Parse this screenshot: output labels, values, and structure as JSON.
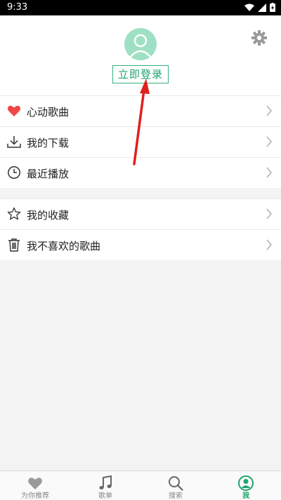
{
  "status": {
    "time": "9:33"
  },
  "profile": {
    "login_label": "立即登录"
  },
  "menu_group_1": [
    {
      "label": "心动歌曲",
      "icon": "heart-icon"
    },
    {
      "label": "我的下载",
      "icon": "download-icon"
    },
    {
      "label": "最近播放",
      "icon": "clock-icon"
    }
  ],
  "menu_group_2": [
    {
      "label": "我的收藏",
      "icon": "star-icon"
    },
    {
      "label": "我不喜欢的歌曲",
      "icon": "trash-icon"
    }
  ],
  "tabs": [
    {
      "label": "为你推荐",
      "icon": "heart-icon",
      "active": false
    },
    {
      "label": "歌单",
      "icon": "music-note-icon",
      "active": false
    },
    {
      "label": "搜索",
      "icon": "search-icon",
      "active": false
    },
    {
      "label": "我",
      "icon": "user-icon",
      "active": true
    }
  ],
  "colors": {
    "accent": "#1ea36a",
    "avatar_bg": "#9ee0c4",
    "heart": "#f04848",
    "annotation_arrow": "#e02020"
  }
}
